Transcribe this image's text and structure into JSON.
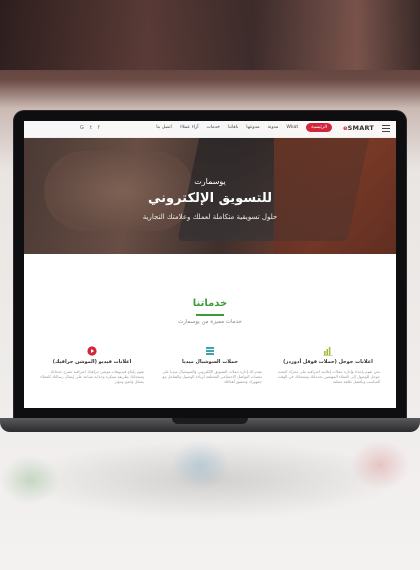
{
  "nav": {
    "logo_prefix": "e",
    "logo_text": "SMART",
    "items": [
      {
        "label": "الرئيسية",
        "active": true
      },
      {
        "label": "Wkat",
        "active": false
      },
      {
        "label": "مدونة",
        "active": false
      },
      {
        "label": "مدونتها",
        "active": false
      },
      {
        "label": "باقاتنا",
        "active": false
      },
      {
        "label": "خدمات",
        "active": false
      },
      {
        "label": "آراء عملاء",
        "active": false
      },
      {
        "label": "اتصل بنا",
        "active": false
      }
    ],
    "social": [
      "G",
      "t",
      "f"
    ]
  },
  "hero": {
    "subtitle": "يوسمارت",
    "title": "للتسويق الإلكتروني",
    "tagline": "حلول تسويقية متكاملة لعملك وعلامتك التجارية"
  },
  "services": {
    "title": "خدماتنا",
    "subtitle": "خدمات مميزة من يوسمارت",
    "cards": [
      {
        "title": "اعلانات جوجل (حملات قوقل أدوردز)",
        "icon": "bar-chart-icon",
        "color": "#9fbf3a",
        "desc": "نحن نقوم بإعداد وإدارة حملات إعلانية احترافية على محرك البحث جوجل للوصول إلى العملاء المهتمين بخدماتك ومنتجاتك في الوقت المناسب وبأفضل تكلفة ممكنة"
      },
      {
        "title": "حملات السوشيال ميديا",
        "icon": "layers-icon",
        "color": "#3fa3a8",
        "desc": "نقدم لك إدارة حملات التسويق الإلكتروني والسوشيال ميديا على منصات التواصل الاجتماعي المختلفة لزيادة الوصول والتفاعل مع جمهورك وتحقيق أهدافك"
      },
      {
        "title": "اعلانات فيديو (الموشن جرافيك)",
        "icon": "play-icon",
        "color": "#d3263d",
        "desc": "نقوم بإنتاج فيديوهات موشن جرافيك احترافية تشرح خدماتك ومنتجاتك بطريقة مبتكرة وجذابة تساعد على إيصال رسالتك للعملاء بشكل واضح ومؤثر"
      }
    ]
  }
}
